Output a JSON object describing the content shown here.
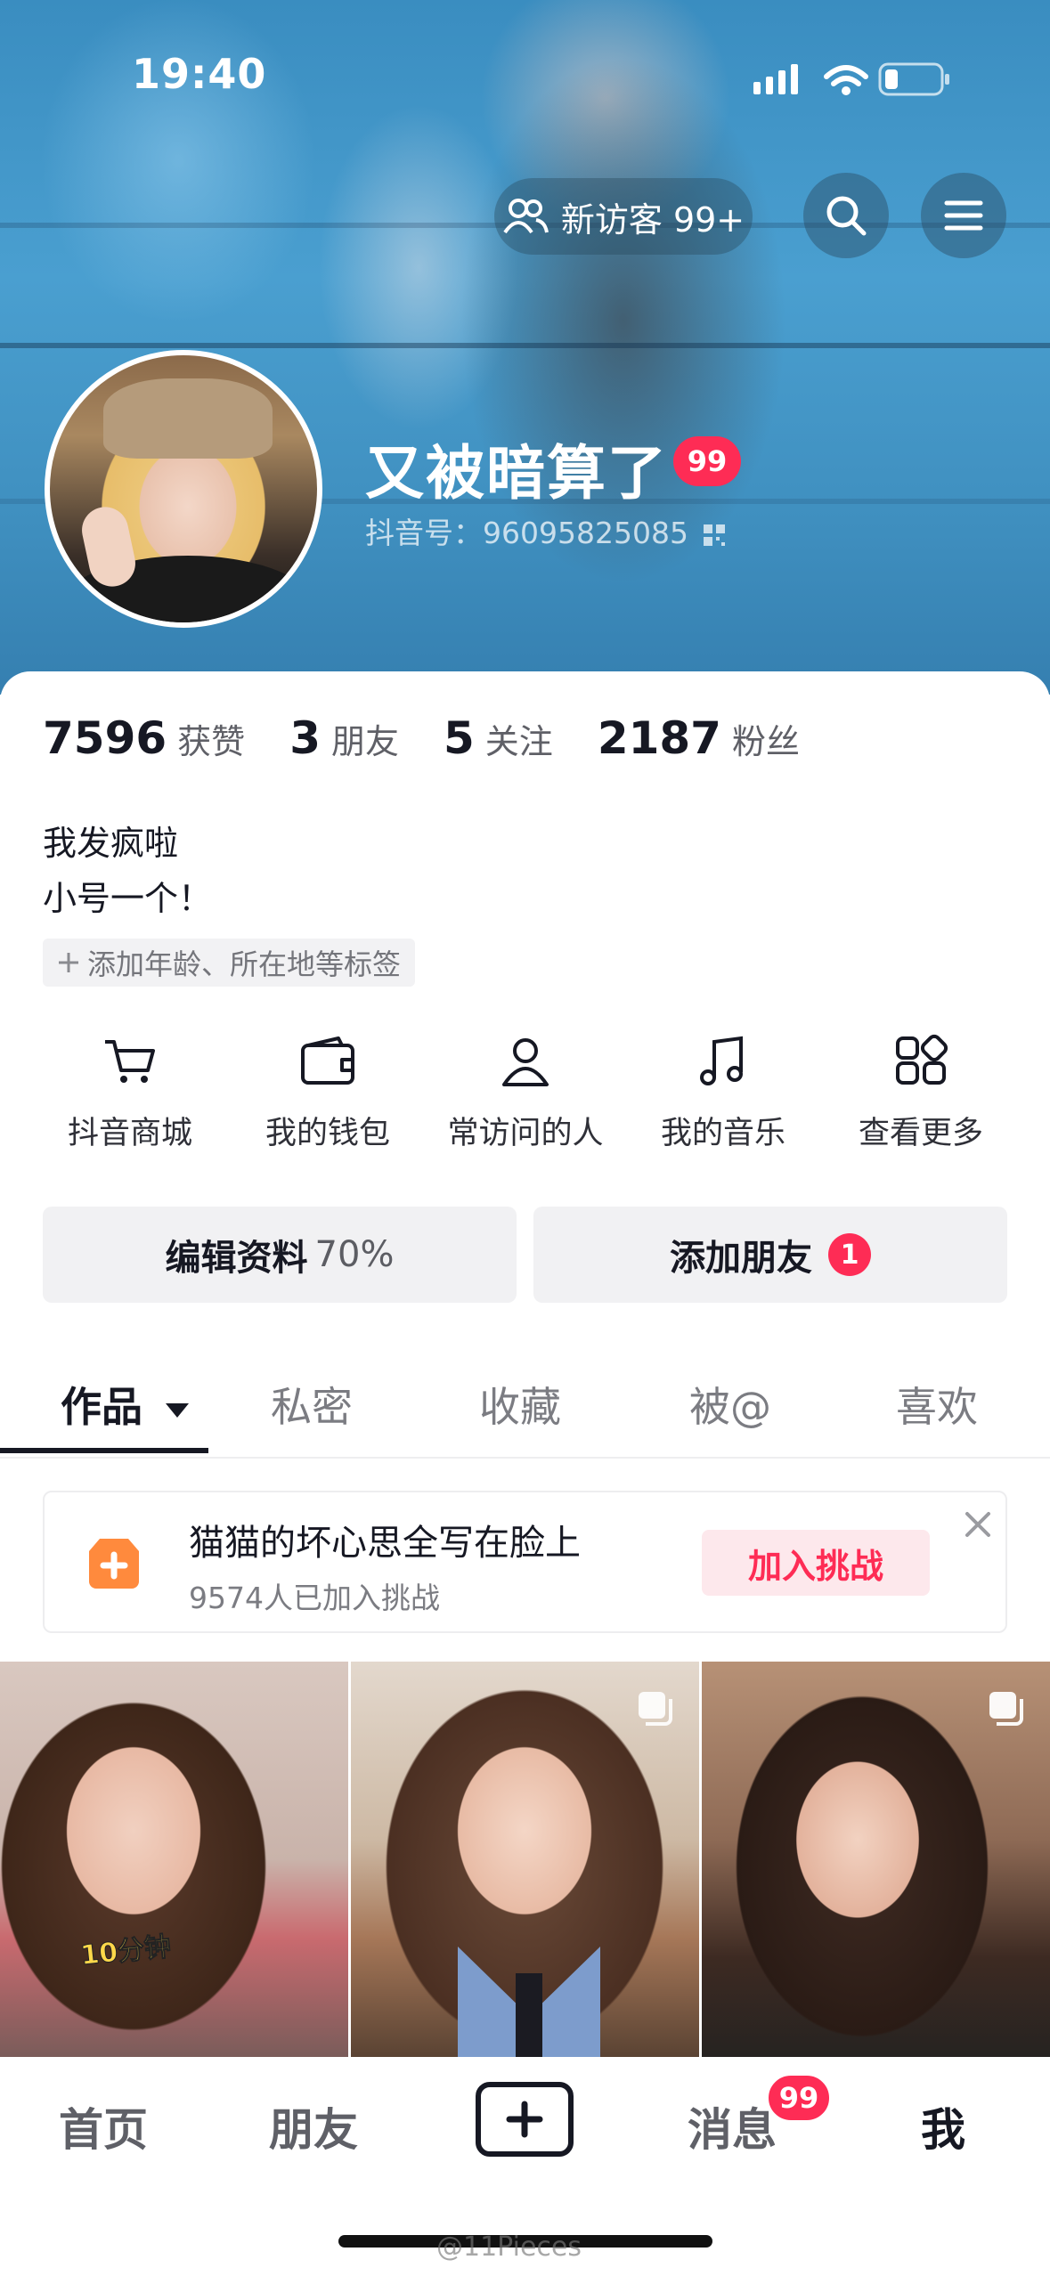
{
  "status_bar": {
    "time": "19:40"
  },
  "header": {
    "visitors_label": "新访客 99+",
    "username": "又被暗算了",
    "badge": "99",
    "douyin_id": "抖音号：96095825085"
  },
  "stats": [
    {
      "number": "7596",
      "label": "获赞"
    },
    {
      "number": "3",
      "label": "朋友"
    },
    {
      "number": "5",
      "label": "关注"
    },
    {
      "number": "2187",
      "label": "粉丝"
    }
  ],
  "bio": {
    "line1": "我发疯啦",
    "line2": "小号一个！"
  },
  "tag_chip": "添加年龄、所在地等标签",
  "shortcuts": [
    {
      "label": "抖音商城",
      "icon": "cart-icon"
    },
    {
      "label": "我的钱包",
      "icon": "wallet-icon"
    },
    {
      "label": "常访问的人",
      "icon": "person-icon"
    },
    {
      "label": "我的音乐",
      "icon": "music-note-icon"
    },
    {
      "label": "查看更多",
      "icon": "grid-more-icon"
    }
  ],
  "actions": {
    "edit_profile": "编辑资料",
    "edit_profile_pct": "70%",
    "add_friends": "添加朋友",
    "add_friends_badge": "1"
  },
  "tabs": [
    {
      "label": "作品",
      "active": true
    },
    {
      "label": "私密",
      "active": false
    },
    {
      "label": "收藏",
      "active": false
    },
    {
      "label": "被@",
      "active": false
    },
    {
      "label": "喜欢",
      "active": false
    }
  ],
  "challenge": {
    "title": "猫猫的坏心思全写在脸上",
    "subtitle": "9574人已加入挑战",
    "join": "加入挑战"
  },
  "videos": [
    {
      "sticker": "10分钟",
      "multi": false
    },
    {
      "sticker": "",
      "multi": true
    },
    {
      "sticker": "",
      "multi": true
    }
  ],
  "bottom_nav": {
    "home": "首页",
    "friends": "朋友",
    "messages": "消息",
    "messages_badge": "99",
    "me": "我"
  },
  "watermark": "@11Pieces",
  "colors": {
    "accent_red": "#fe2c55",
    "text_primary": "#161823",
    "text_secondary": "#5f6067"
  }
}
